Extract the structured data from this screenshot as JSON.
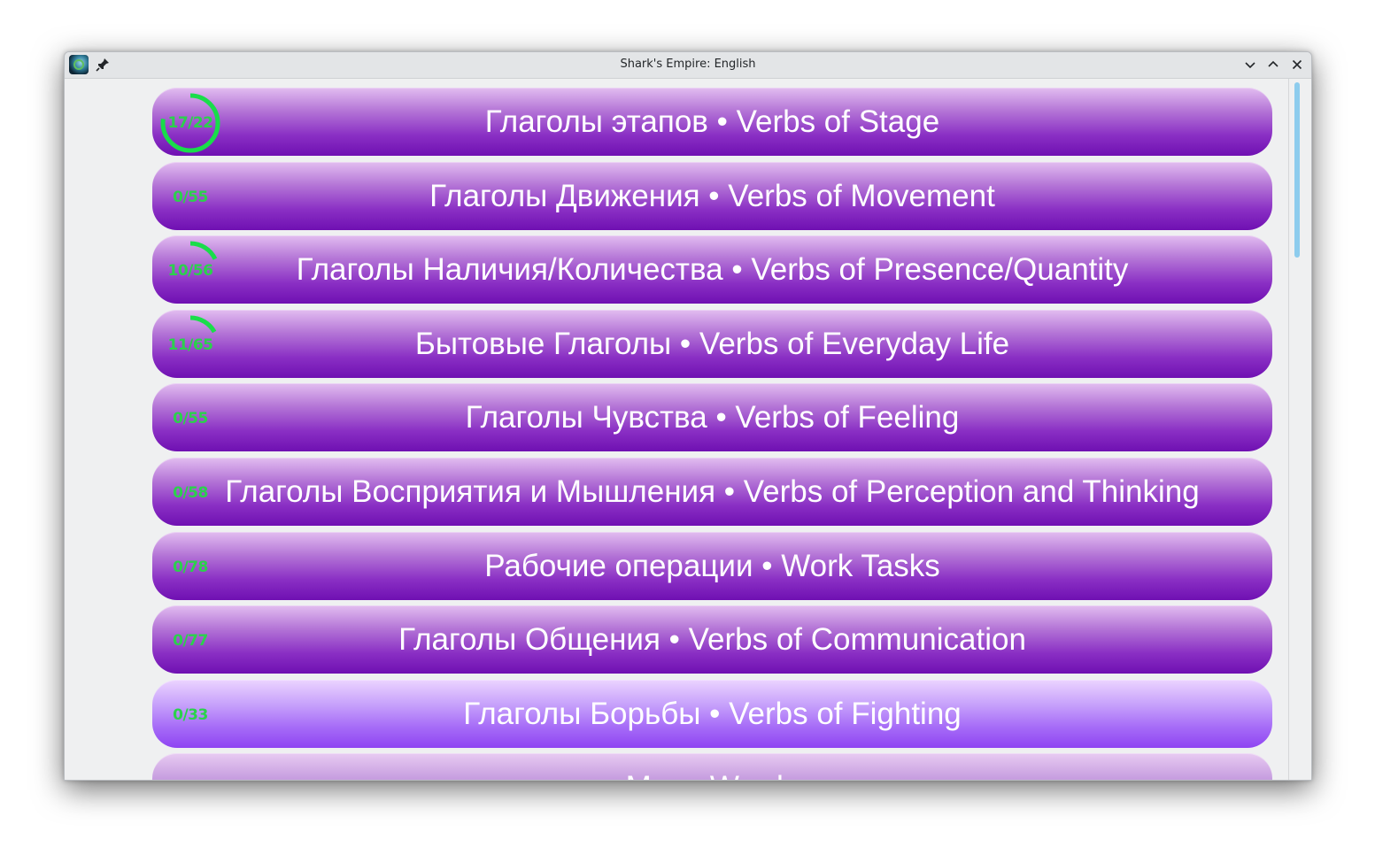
{
  "window": {
    "title": "Shark's Empire: English"
  },
  "accent": {
    "progress": "#19dd4a",
    "button": "#8a2fc4",
    "button_highlight": "#a66bf7"
  },
  "categories": [
    {
      "label": "Глаголы этапов • Verbs of Stage",
      "progress_text": "17/22",
      "done": 17,
      "total": 22
    },
    {
      "label": "Глаголы Движения • Verbs of Movement",
      "progress_text": "0/55",
      "done": 0,
      "total": 55
    },
    {
      "label": "Глаголы Наличия/Количества • Verbs of Presence/Quantity",
      "progress_text": "10/56",
      "done": 10,
      "total": 56
    },
    {
      "label": "Бытовые Глаголы • Verbs of Everyday Life",
      "progress_text": "11/65",
      "done": 11,
      "total": 65
    },
    {
      "label": "Глаголы Чувства • Verbs of Feeling",
      "progress_text": "0/55",
      "done": 0,
      "total": 55
    },
    {
      "label": "Глаголы Восприятия и Мышления • Verbs of Perception and Thinking",
      "progress_text": "0/58",
      "done": 0,
      "total": 58
    },
    {
      "label": "Рабочие операции • Work Tasks",
      "progress_text": "0/78",
      "done": 0,
      "total": 78
    },
    {
      "label": "Глаголы Общения • Verbs of Communication",
      "progress_text": "0/77",
      "done": 0,
      "total": 77
    },
    {
      "label": "Глаголы Борьбы • Verbs of Fighting",
      "progress_text": "0/33",
      "done": 0,
      "total": 33,
      "highlighted": true
    },
    {
      "label": "Many Words",
      "progress_text": "",
      "partially_visible": true
    }
  ]
}
